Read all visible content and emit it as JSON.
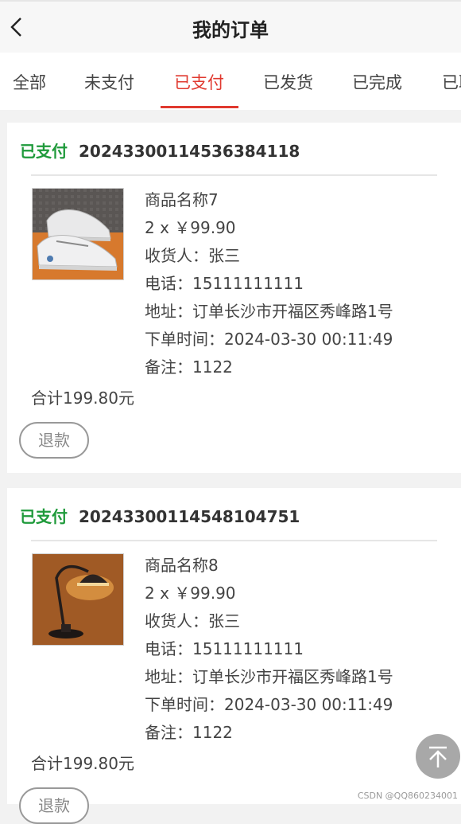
{
  "header": {
    "title": "我的订单"
  },
  "tabs": [
    {
      "label": "全部"
    },
    {
      "label": "未支付"
    },
    {
      "label": "已支付"
    },
    {
      "label": "已发货"
    },
    {
      "label": "已完成"
    },
    {
      "label": "已取"
    }
  ],
  "active_tab_index": 2,
  "orders": [
    {
      "status": "已支付",
      "order_no": "20243300114536384118",
      "product_name": "商品名称7",
      "qty_price": "2 x ￥99.90",
      "receiver": "收货人：张三",
      "phone": "电话：15111111111",
      "address": "地址：订单长沙市开福区秀峰路1号",
      "order_time": "下单时间：2024-03-30 00:11:49",
      "note": "备注：1122",
      "total": "合计199.80元",
      "refund_label": "退款",
      "image": "sneakers"
    },
    {
      "status": "已支付",
      "order_no": "20243300114548104751",
      "product_name": "商品名称8",
      "qty_price": "2 x ￥99.90",
      "receiver": "收货人：张三",
      "phone": "电话：15111111111",
      "address": "地址：订单长沙市开福区秀峰路1号",
      "order_time": "下单时间：2024-03-30 00:11:49",
      "note": "备注：1122",
      "total": "合计199.80元",
      "refund_label": "退款",
      "image": "desk-lamp"
    }
  ],
  "watermark": "CSDN @QQ860234001",
  "colors": {
    "accent": "#e0392f",
    "status_green": "#1f9a3b"
  }
}
